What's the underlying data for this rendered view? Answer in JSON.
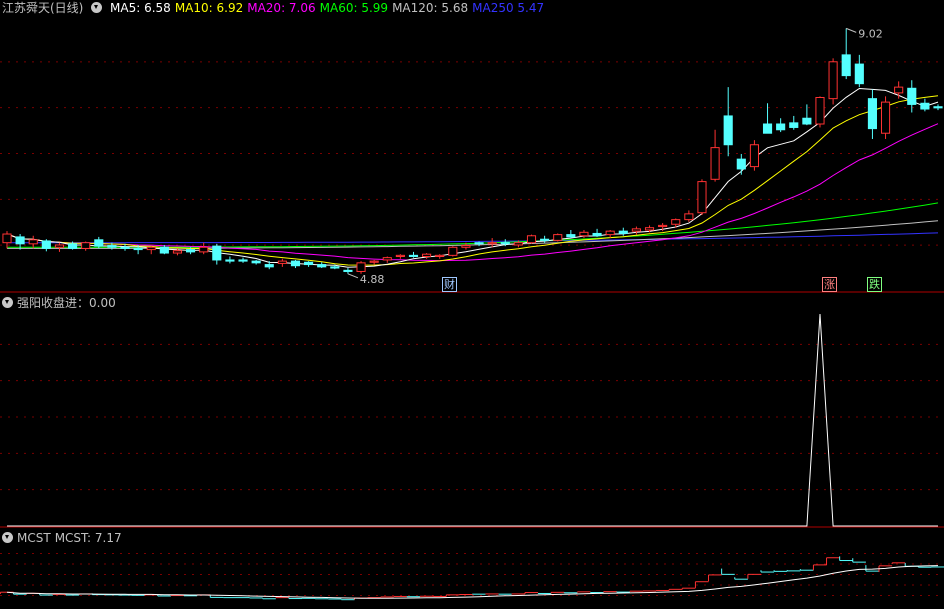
{
  "main": {
    "title": "江苏舜天(日线)",
    "ma": [
      {
        "name": "MA5",
        "sep": ": ",
        "value": "6.58",
        "color": "#ffffff"
      },
      {
        "name": "MA10",
        "sep": ": ",
        "value": "6.92",
        "color": "#ffff00"
      },
      {
        "name": "MA20",
        "sep": ": ",
        "value": "7.06",
        "color": "#ff00ff"
      },
      {
        "name": "MA60",
        "sep": ": ",
        "value": "5.99",
        "color": "#00ff00"
      },
      {
        "name": "MA120",
        "sep": ": ",
        "value": "5.68",
        "color": "#c0c0c0"
      },
      {
        "name": "MA250",
        "sep": " ",
        "value": "5.47",
        "color": "#3333ff"
      }
    ],
    "high_label": "9.02",
    "low_label": "4.88",
    "markers": [
      {
        "text": "财",
        "color": "#a0c8ff"
      },
      {
        "text": "涨",
        "color": "#ff8080"
      },
      {
        "text": "跌",
        "color": "#80ff80"
      }
    ]
  },
  "sub1": {
    "title": "强阳收盘进",
    "value_text": "：0.00"
  },
  "sub2": {
    "title": "MCST",
    "value_text": "MCST: 7.17"
  },
  "colors": {
    "up": "#ff3232",
    "down": "#54ffff",
    "grid": "#7a0000",
    "border": "#b00000"
  },
  "chart_data": [
    {
      "type": "candlestick",
      "title": "江苏舜天(日线)",
      "candles": [
        {
          "o": 5.3,
          "h": 5.5,
          "l": 5.2,
          "c": 5.45
        },
        {
          "o": 5.4,
          "h": 5.45,
          "l": 5.18,
          "c": 5.28
        },
        {
          "o": 5.28,
          "h": 5.42,
          "l": 5.2,
          "c": 5.35
        },
        {
          "o": 5.33,
          "h": 5.36,
          "l": 5.15,
          "c": 5.2
        },
        {
          "o": 5.22,
          "h": 5.3,
          "l": 5.14,
          "c": 5.26
        },
        {
          "o": 5.28,
          "h": 5.32,
          "l": 5.18,
          "c": 5.2
        },
        {
          "o": 5.2,
          "h": 5.32,
          "l": 5.16,
          "c": 5.3
        },
        {
          "o": 5.35,
          "h": 5.4,
          "l": 5.2,
          "c": 5.24
        },
        {
          "o": 5.25,
          "h": 5.3,
          "l": 5.18,
          "c": 5.22
        },
        {
          "o": 5.22,
          "h": 5.28,
          "l": 5.16,
          "c": 5.2
        },
        {
          "o": 5.2,
          "h": 5.26,
          "l": 5.1,
          "c": 5.18
        },
        {
          "o": 5.18,
          "h": 5.24,
          "l": 5.1,
          "c": 5.22
        },
        {
          "o": 5.22,
          "h": 5.26,
          "l": 5.1,
          "c": 5.12
        },
        {
          "o": 5.12,
          "h": 5.2,
          "l": 5.08,
          "c": 5.16
        },
        {
          "o": 5.18,
          "h": 5.22,
          "l": 5.1,
          "c": 5.14
        },
        {
          "o": 5.14,
          "h": 5.3,
          "l": 5.1,
          "c": 5.22
        },
        {
          "o": 5.24,
          "h": 5.28,
          "l": 4.92,
          "c": 5.0
        },
        {
          "o": 5.0,
          "h": 5.06,
          "l": 4.94,
          "c": 4.98
        },
        {
          "o": 5.0,
          "h": 5.04,
          "l": 4.95,
          "c": 4.98
        },
        {
          "o": 4.98,
          "h": 5.0,
          "l": 4.92,
          "c": 4.95
        },
        {
          "o": 4.92,
          "h": 4.98,
          "l": 4.84,
          "c": 4.88
        },
        {
          "o": 4.94,
          "h": 5.02,
          "l": 4.88,
          "c": 4.98
        },
        {
          "o": 4.98,
          "h": 5.0,
          "l": 4.86,
          "c": 4.9
        },
        {
          "o": 4.96,
          "h": 4.98,
          "l": 4.88,
          "c": 4.92
        },
        {
          "o": 4.92,
          "h": 4.96,
          "l": 4.86,
          "c": 4.88
        },
        {
          "o": 4.88,
          "h": 4.92,
          "l": 4.84,
          "c": 4.86
        },
        {
          "o": 4.82,
          "h": 4.86,
          "l": 4.76,
          "c": 4.8
        },
        {
          "o": 4.8,
          "h": 4.98,
          "l": 4.76,
          "c": 4.95
        },
        {
          "o": 4.96,
          "h": 5.0,
          "l": 4.92,
          "c": 4.98
        },
        {
          "o": 5.0,
          "h": 5.06,
          "l": 4.95,
          "c": 5.04
        },
        {
          "o": 5.06,
          "h": 5.1,
          "l": 5.02,
          "c": 5.08
        },
        {
          "o": 5.08,
          "h": 5.14,
          "l": 5.04,
          "c": 5.06
        },
        {
          "o": 5.06,
          "h": 5.12,
          "l": 5.02,
          "c": 5.1
        },
        {
          "o": 5.06,
          "h": 5.1,
          "l": 5.02,
          "c": 5.08
        },
        {
          "o": 5.08,
          "h": 5.24,
          "l": 5.06,
          "c": 5.22
        },
        {
          "o": 5.22,
          "h": 5.3,
          "l": 5.18,
          "c": 5.25
        },
        {
          "o": 5.3,
          "h": 5.32,
          "l": 5.24,
          "c": 5.28
        },
        {
          "o": 5.28,
          "h": 5.38,
          "l": 5.22,
          "c": 5.3
        },
        {
          "o": 5.3,
          "h": 5.36,
          "l": 5.24,
          "c": 5.28
        },
        {
          "o": 5.26,
          "h": 5.34,
          "l": 5.22,
          "c": 5.3
        },
        {
          "o": 5.3,
          "h": 5.44,
          "l": 5.28,
          "c": 5.42
        },
        {
          "o": 5.36,
          "h": 5.42,
          "l": 5.3,
          "c": 5.34
        },
        {
          "o": 5.34,
          "h": 5.46,
          "l": 5.32,
          "c": 5.44
        },
        {
          "o": 5.44,
          "h": 5.52,
          "l": 5.38,
          "c": 5.4
        },
        {
          "o": 5.42,
          "h": 5.52,
          "l": 5.38,
          "c": 5.48
        },
        {
          "o": 5.46,
          "h": 5.54,
          "l": 5.4,
          "c": 5.42
        },
        {
          "o": 5.44,
          "h": 5.52,
          "l": 5.38,
          "c": 5.5
        },
        {
          "o": 5.5,
          "h": 5.56,
          "l": 5.42,
          "c": 5.46
        },
        {
          "o": 5.5,
          "h": 5.58,
          "l": 5.44,
          "c": 5.54
        },
        {
          "o": 5.52,
          "h": 5.6,
          "l": 5.48,
          "c": 5.56
        },
        {
          "o": 5.58,
          "h": 5.64,
          "l": 5.5,
          "c": 5.6
        },
        {
          "o": 5.62,
          "h": 5.72,
          "l": 5.56,
          "c": 5.7
        },
        {
          "o": 5.7,
          "h": 5.86,
          "l": 5.66,
          "c": 5.8
        },
        {
          "o": 5.82,
          "h": 6.4,
          "l": 5.78,
          "c": 6.36
        },
        {
          "o": 6.4,
          "h": 7.26,
          "l": 6.36,
          "c": 6.95
        },
        {
          "o": 7.5,
          "h": 8.0,
          "l": 6.8,
          "c": 7.0
        },
        {
          "o": 6.75,
          "h": 6.84,
          "l": 6.48,
          "c": 6.58
        },
        {
          "o": 6.62,
          "h": 7.08,
          "l": 6.55,
          "c": 7.0
        },
        {
          "o": 7.36,
          "h": 7.72,
          "l": 7.2,
          "c": 7.2
        },
        {
          "o": 7.36,
          "h": 7.46,
          "l": 7.22,
          "c": 7.26
        },
        {
          "o": 7.38,
          "h": 7.5,
          "l": 7.26,
          "c": 7.3
        },
        {
          "o": 7.46,
          "h": 7.7,
          "l": 7.34,
          "c": 7.36
        },
        {
          "o": 7.36,
          "h": 7.84,
          "l": 7.3,
          "c": 7.82
        },
        {
          "o": 7.8,
          "h": 8.5,
          "l": 7.7,
          "c": 8.44
        },
        {
          "o": 8.56,
          "h": 9.02,
          "l": 8.14,
          "c": 8.2
        },
        {
          "o": 8.4,
          "h": 8.56,
          "l": 8.0,
          "c": 8.06
        },
        {
          "o": 7.8,
          "h": 7.96,
          "l": 7.1,
          "c": 7.28
        },
        {
          "o": 7.2,
          "h": 7.84,
          "l": 7.1,
          "c": 7.74
        },
        {
          "o": 7.9,
          "h": 8.1,
          "l": 7.8,
          "c": 8.0
        },
        {
          "o": 7.98,
          "h": 8.12,
          "l": 7.56,
          "c": 7.7
        },
        {
          "o": 7.72,
          "h": 7.8,
          "l": 7.58,
          "c": 7.62
        },
        {
          "o": 7.66,
          "h": 7.7,
          "l": 7.6,
          "c": 7.64
        }
      ],
      "ma": {
        "MA5": 6.58,
        "MA10": 6.92,
        "MA20": 7.06,
        "MA60": 5.99,
        "MA120": 5.68,
        "MA250": 5.47
      },
      "high": 9.02,
      "low": 4.88
    },
    {
      "type": "line",
      "title": "强阳收盘进",
      "values": [
        0,
        0,
        0,
        0,
        0,
        0,
        0,
        0,
        0,
        0,
        0,
        0,
        0,
        0,
        0,
        0,
        0,
        0,
        0,
        0,
        0,
        0,
        0,
        0,
        0,
        0,
        0,
        0,
        0,
        0,
        0,
        0,
        0,
        0,
        0,
        0,
        0,
        0,
        0,
        0,
        0,
        0,
        0,
        0,
        0,
        0,
        0,
        0,
        0,
        0,
        0,
        0,
        0,
        0,
        0,
        0,
        0,
        0,
        0,
        0,
        0,
        0,
        1,
        0,
        0,
        0,
        0,
        0,
        0,
        0,
        0,
        0
      ],
      "ylim": [
        0,
        1
      ]
    },
    {
      "type": "line",
      "title": "MCST",
      "last_value": 7.17
    }
  ]
}
